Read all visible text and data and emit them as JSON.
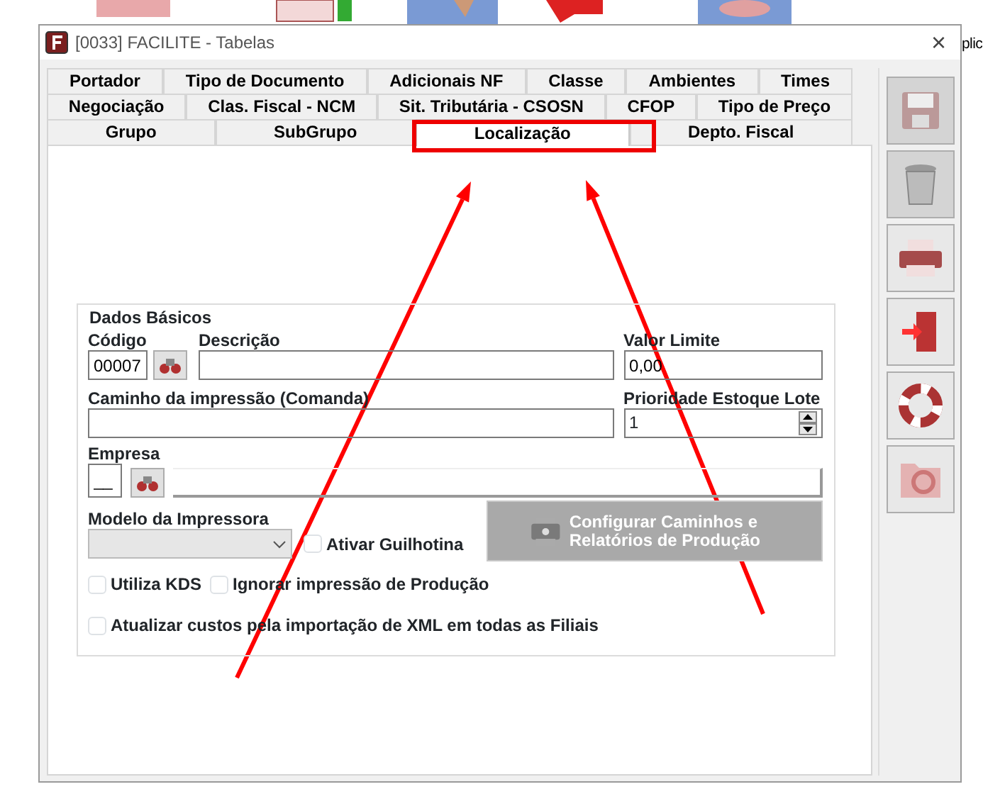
{
  "background_app_text": "plic",
  "window": {
    "title": "[0033] FACILITE - Tabelas",
    "close": "×"
  },
  "tab_rows": [
    [
      {
        "label": "Portador",
        "selected": false
      },
      {
        "label": "Tipo de Documento",
        "selected": false
      },
      {
        "label": "Adicionais NF",
        "selected": false
      },
      {
        "label": "Classe",
        "selected": false
      },
      {
        "label": "Ambientes",
        "selected": false
      },
      {
        "label": "Times",
        "selected": false
      }
    ],
    [
      {
        "label": "Negociação",
        "selected": false
      },
      {
        "label": "Clas. Fiscal - NCM",
        "selected": false
      },
      {
        "label": "Sit. Tributária - CSOSN",
        "selected": false
      },
      {
        "label": "CFOP",
        "selected": false
      },
      {
        "label": "Tipo de Preço",
        "selected": false
      }
    ],
    [
      {
        "label": "Grupo",
        "selected": false
      },
      {
        "label": "SubGrupo",
        "selected": false
      },
      {
        "label": "Localização",
        "selected": true
      },
      {
        "label": "Depto. Fiscal",
        "selected": false
      }
    ]
  ],
  "group": {
    "title": "Dados Básicos",
    "codigo": {
      "label": "Código",
      "value": "00007"
    },
    "descricao": {
      "label": "Descrição"
    },
    "valor_limite": {
      "label": "Valor Limite",
      "value": "0,00"
    },
    "caminho": {
      "label": "Caminho da impressão (Comanda)"
    },
    "prioridade": {
      "label": "Prioridade Estoque Lote",
      "value": "1"
    },
    "empresa": {
      "label": "Empresa",
      "value": "__"
    },
    "modelo": {
      "label": "Modelo da Impressora"
    },
    "configurar_button": {
      "label": "Configurar Caminhos e Relatórios de Produção",
      "disabled": true
    },
    "checkboxes": [
      {
        "label": "Ativar Guilhotina",
        "checked": false
      },
      {
        "label": "Utiliza KDS",
        "checked": false
      },
      {
        "label": "Ignorar impressão de Produção",
        "checked": false
      },
      {
        "label": "Atualizar custos pela importação de XML em todas as Filiais",
        "checked": false
      }
    ]
  },
  "sidebar_buttons": [
    {
      "kind": "save",
      "disabled": true
    },
    {
      "kind": "delete",
      "disabled": true
    },
    {
      "kind": "print",
      "disabled": false
    },
    {
      "kind": "exit",
      "disabled": false
    },
    {
      "kind": "help",
      "disabled": false
    },
    {
      "kind": "settings",
      "disabled": false
    }
  ],
  "annotations": [
    {
      "kind": "highlight"
    },
    {
      "kind": "arrow"
    },
    {
      "kind": "arrow"
    }
  ]
}
